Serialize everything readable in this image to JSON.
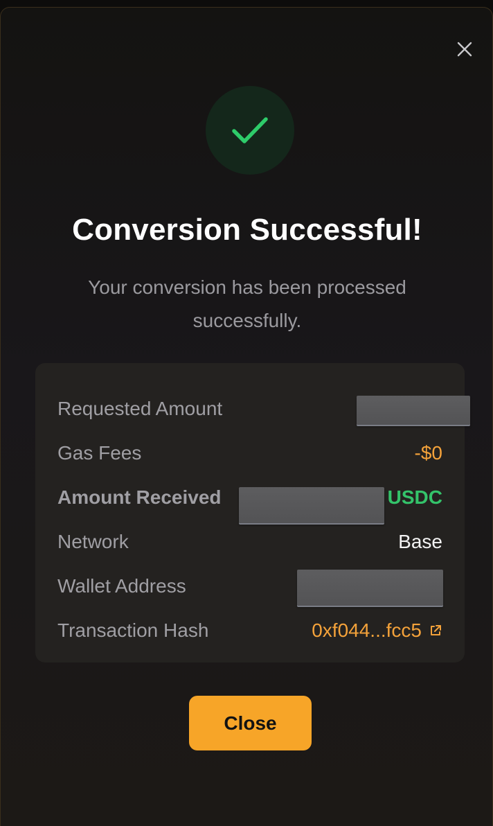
{
  "modal": {
    "title": "Conversion Successful!",
    "subtitle": "Your conversion has been processed successfully.",
    "close_icon": "close-icon",
    "success_icon": "checkmark-icon",
    "close_button_label": "Close"
  },
  "details": {
    "rows": [
      {
        "label": "Requested Amount",
        "value": "",
        "redacted": true
      },
      {
        "label": "Gas Fees",
        "value": "-$0"
      },
      {
        "label": "Amount Received",
        "value": "USDC",
        "redacted": true
      },
      {
        "label": "Network",
        "value": "Base"
      },
      {
        "label": "Wallet Address",
        "value": "",
        "redacted": true
      },
      {
        "label": "Transaction Hash",
        "value": "0xf044...fcc5",
        "link_icon": "external-link-icon"
      }
    ]
  },
  "colors": {
    "accent": "#f7a528",
    "success": "#34c36a",
    "fee": "#f4a23a",
    "background": "#161412",
    "panel": "#242220"
  }
}
